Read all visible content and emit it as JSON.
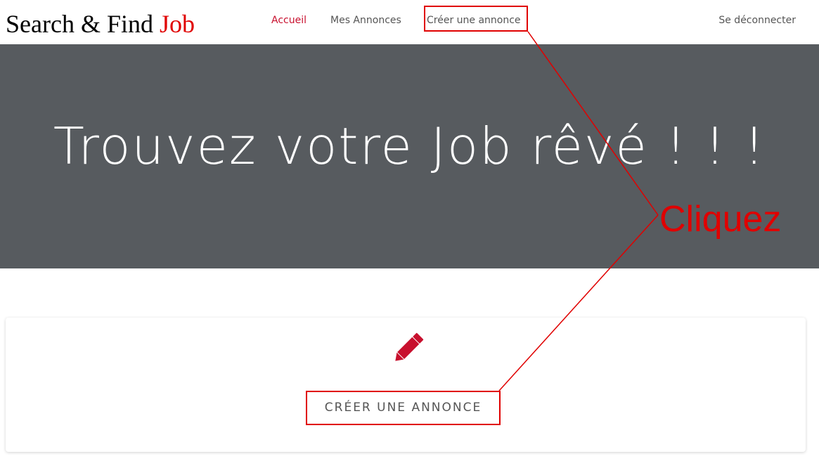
{
  "brand": {
    "text": "Search & Find ",
    "accent": "Job"
  },
  "nav": {
    "accueil": "Accueil",
    "mes_annonces": "Mes Annonces",
    "creer_annonce": "Créer une annonce",
    "logout": "Se déconnecter"
  },
  "hero": {
    "title": "Trouvez votre Job rêvé ! ! !"
  },
  "annotation": {
    "label": "Cliquez"
  },
  "card": {
    "icon": "pencil-icon",
    "cta_label": "CRÉER UNE ANNONCE"
  },
  "colors": {
    "accent": "#c8102e",
    "annotation": "#e00000",
    "hero_background": "#575b5f",
    "nav_text": "#555555"
  }
}
